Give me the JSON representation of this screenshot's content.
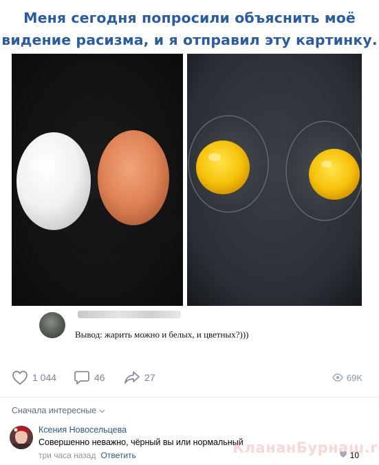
{
  "headline": {
    "line1": "Меня сегодня попросили объяснить моё",
    "line2": "видение расизма, и я отправил эту картинку."
  },
  "images": {
    "left": {
      "description_icon": "eggs-photo",
      "colors": {
        "bg": "#141313",
        "white_egg": "#f2f2f3",
        "brown_egg": "#e0835a"
      }
    },
    "right": {
      "description_icon": "fried-eggs-photo",
      "colors": {
        "pan": "#2e3238",
        "yolk": "#f7c20a"
      }
    }
  },
  "caption": {
    "text": "Вывод: жарить можно и белых, и цветных?)))"
  },
  "actions": {
    "likes": "1 044",
    "comments": "46",
    "shares": "27",
    "views": "69K"
  },
  "comments_section": {
    "sort_label": "Сначала интересные",
    "items": [
      {
        "author": "Ксения Новосельцева",
        "text": "Совершенно неважно, чёрный вы или нормальный",
        "time": "три часа назад",
        "reply_label": "Ответить",
        "likes": "10"
      }
    ]
  },
  "watermark": "КлананБурнаш.ruЛП",
  "colors": {
    "headline": "#2a5d9f",
    "link": "#2a5885",
    "muted": "#7b8591"
  }
}
